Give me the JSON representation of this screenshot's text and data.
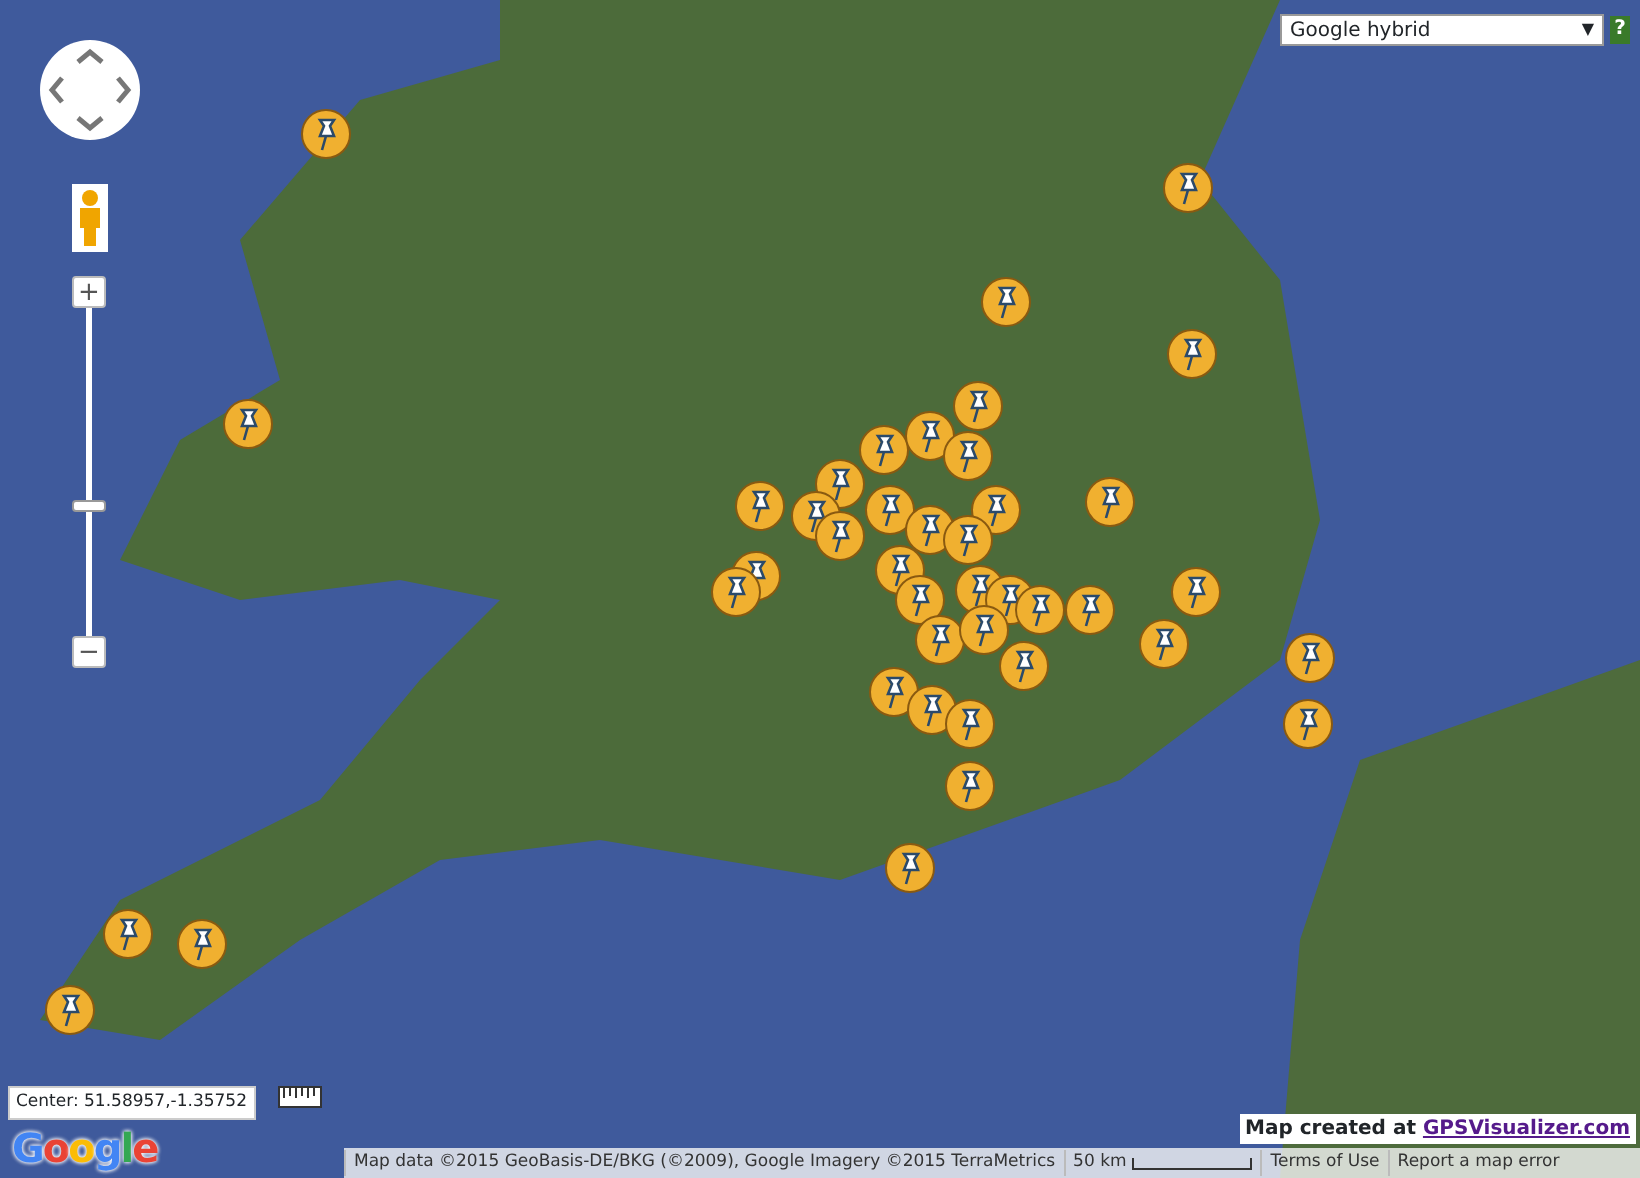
{
  "map_type": {
    "value": "Google hybrid",
    "caret": "▼"
  },
  "help": "?",
  "zoom": {
    "plus": "+",
    "minus": "−",
    "level": 0.39
  },
  "center": "Center: 51.58957,-1.35752",
  "logo": "Google",
  "credit": {
    "prefix": "Map created at ",
    "link": "GPSVisualizer.com"
  },
  "footer": {
    "attribution": "Map data ©2015 GeoBasis-DE/BKG (©2009), Google Imagery ©2015 TerraMetrics",
    "scale": "50 km",
    "links": [
      "Terms of Use",
      "Report a map error"
    ]
  }
}
